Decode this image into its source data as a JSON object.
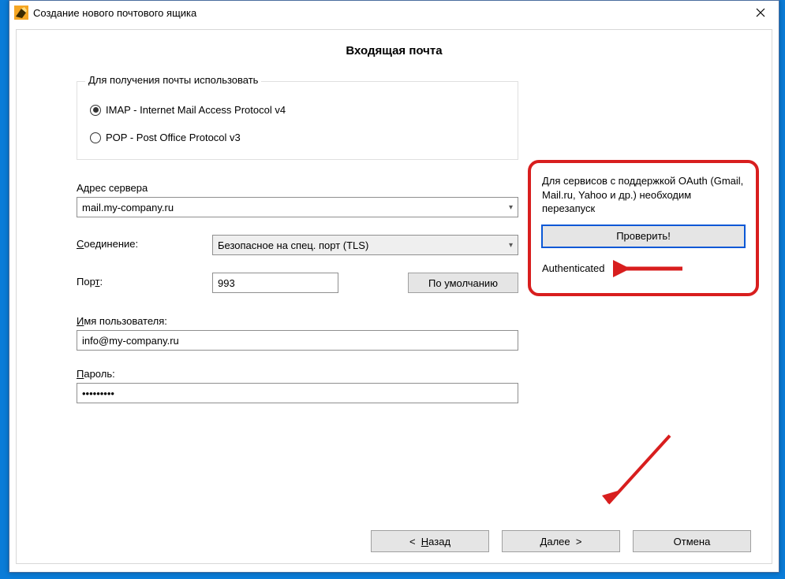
{
  "window": {
    "title": "Создание нового почтового ящика"
  },
  "page": {
    "heading": "Входящая почта"
  },
  "protocol": {
    "legend": "Для получения почты использовать",
    "imap_label": "IMAP - Internet Mail Access Protocol v4",
    "pop_label": "POP  -  Post Office Protocol v3",
    "selected": "imap"
  },
  "server": {
    "label": "Адрес сервера",
    "value": "mail.my-company.ru"
  },
  "connection": {
    "label": "Соединение:",
    "value": "Безопасное на спец. порт (TLS)"
  },
  "port": {
    "label": "Порт:",
    "value": "993",
    "default_button": "По умолчанию"
  },
  "username": {
    "label": "Имя пользователя:",
    "value": "info@my-company.ru"
  },
  "password": {
    "label": "Пароль:",
    "value": "•••••••••"
  },
  "oauth_box": {
    "note": "Для сервисов с поддержкой OAuth (Gmail, Mail.ru, Yahoo и др.) необходим перезапуск",
    "check_button": "Проверить!",
    "status": "Authenticated"
  },
  "footer": {
    "back": "<  Назад",
    "next": "Далее  >",
    "cancel": "Отмена"
  }
}
